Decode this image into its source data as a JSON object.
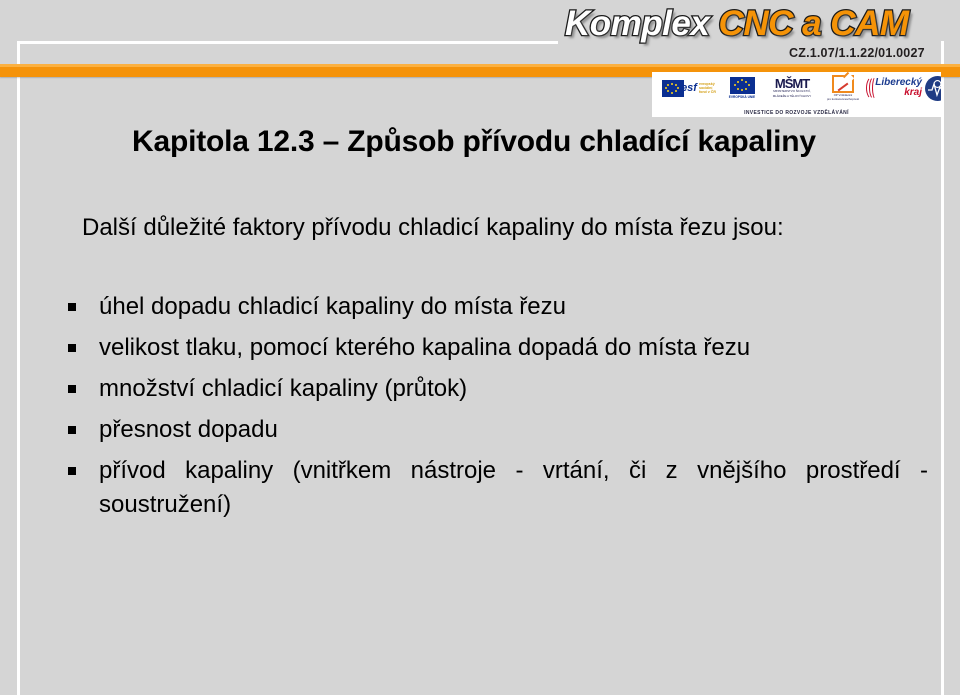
{
  "slide": {
    "title": "Kapitola 12.3 – Způsob přívodu chladící kapaliny",
    "intro": "Další důležité faktory přívodu chladicí kapaliny do místa řezu jsou:",
    "bullets": [
      "úhel dopadu chladicí kapaliny do místa řezu",
      "velikost tlaku, pomocí kterého kapalina dopadá do místa řezu",
      "množství chladicí kapaliny (průtok)",
      "přesnost dopadu",
      "přívod kapaliny (vnitřkem nástroje - vrtání, či z vnějšího prostředí -soustružení)"
    ]
  },
  "branding": {
    "wordmark_white": "Komplex ",
    "wordmark_orange": "CNC a CAM",
    "project_code": "CZ.1.07/1.1.22/01.0027",
    "funding_caption": "INVESTICE DO ROZVOJE VZDĚLÁVÁNÍ",
    "logos": {
      "esf_text": "esf",
      "esf_sub_1": "evropský",
      "esf_sub_2": "sociální",
      "esf_sub_3": "fond v ČR",
      "eu_caption": "EVROPSKÁ UNIE",
      "msmt_mark": "MŠMT",
      "msmt_caption_1": "MINISTERSTVO ŠKOLSTVÍ,",
      "msmt_caption_2": "MLÁDEŽE A TĚLOVÝCHOVY",
      "opvk_caption_1": "OP Vzdělávání",
      "opvk_caption_2": "pro konkurenceschopnost",
      "lk_line1": "Liberecký",
      "lk_line2": "kraj"
    }
  },
  "colors": {
    "background": "#d5d5d5",
    "accent_orange": "#f5930a",
    "frame_white": "#ffffff",
    "text_black": "#000000",
    "eu_blue": "#0b2f91",
    "lk_red": "#c8102e"
  }
}
